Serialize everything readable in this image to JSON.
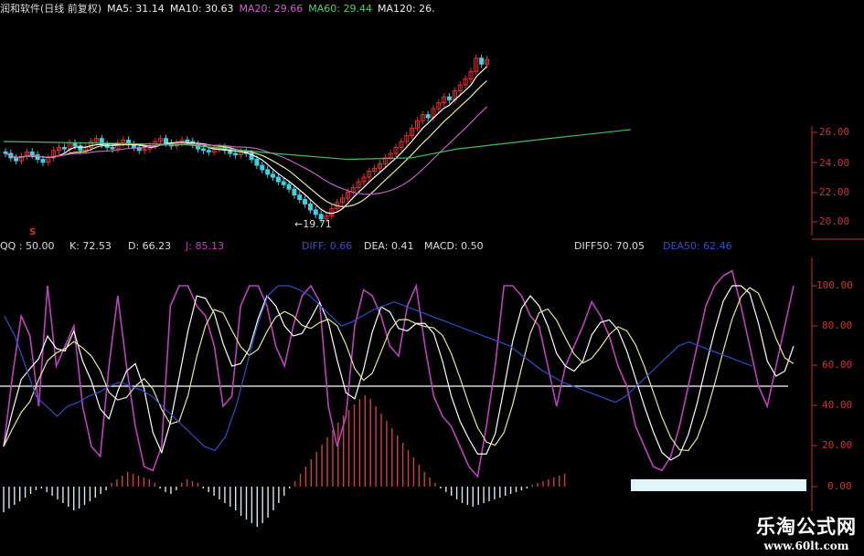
{
  "price_header": {
    "title": "润和软件(日线 前复权)",
    "ma5": "MA5: 31.14",
    "ma10": "MA10: 30.63",
    "ma20": "MA20: 29.66",
    "ma60": "MA60: 29.44",
    "ma120": "MA120: 26."
  },
  "indicator_header": {
    "qq": "QQ : 50.00",
    "k": "K: 72.53",
    "d": "D: 66.23",
    "j": "J: 85.13",
    "diff": "DIFF: 0.66",
    "dea": "DEA: 0.41",
    "macd": "MACD: 0.50",
    "diff50": "DIFF50: 70.05",
    "dea50": "DEA50: 62.46"
  },
  "price_axis": [
    "26.00",
    "24.00",
    "22.00",
    "20.00"
  ],
  "indicator_axis": [
    "100.00",
    "80.00",
    "60.00",
    "40.00",
    "20.00",
    "0.00"
  ],
  "low_marker": "←19.71",
  "signal_mark": "S",
  "watermark": {
    "title": "乐淘公式网",
    "url": "www.60lt.com"
  },
  "colors": {
    "up": "#e03030",
    "down": "#40d0e0",
    "ma5": "#ffffff",
    "ma10": "#e8e8a0",
    "ma20": "#c060c0",
    "ma60": "#40c060",
    "j": "#c040c0",
    "blue": "#3050d0",
    "axis": "#c03030"
  }
}
